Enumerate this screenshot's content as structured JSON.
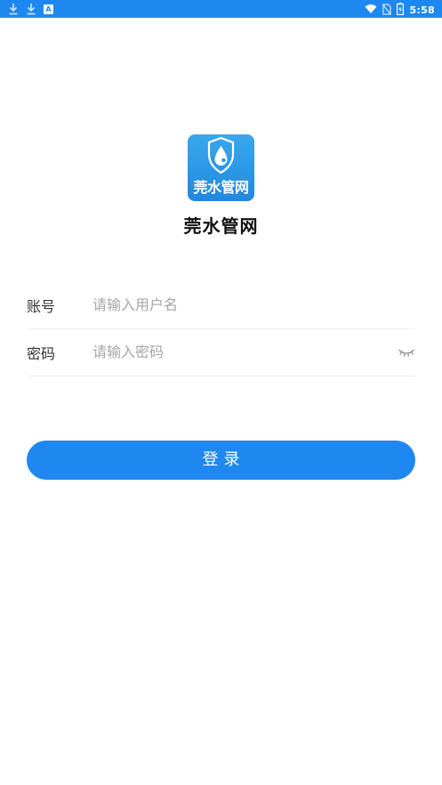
{
  "status_bar": {
    "time": "5:58",
    "a_badge": "A",
    "icons": [
      "download-icon",
      "download-icon",
      "a-badge-icon",
      "wifi-icon",
      "no-sim-icon",
      "battery-charging-icon"
    ]
  },
  "app": {
    "logo_text": "莞水管网",
    "name": "莞水管网"
  },
  "form": {
    "username_label": "账号",
    "username_placeholder": "请输入用户名",
    "username_value": "",
    "password_label": "密码",
    "password_placeholder": "请输入密码",
    "password_value": ""
  },
  "login_button": {
    "label": "登录"
  },
  "colors": {
    "primary": "#1E88F0",
    "placeholder": "#A6A6A6",
    "label": "#333333",
    "divider": "#EEEEEE"
  }
}
